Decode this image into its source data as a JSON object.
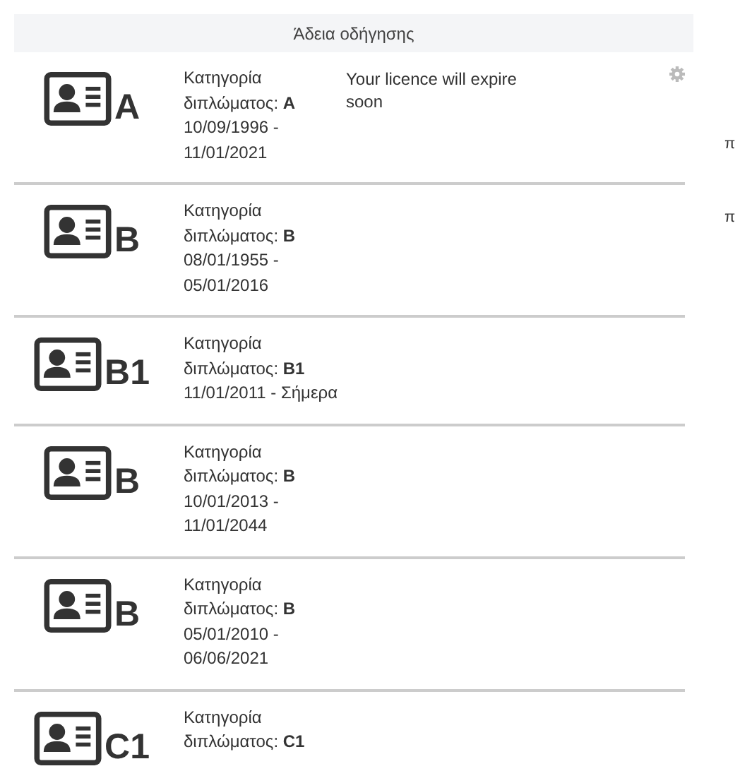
{
  "header": {
    "title": "Άδεια οδήγησης"
  },
  "licences": [
    {
      "category": "A",
      "description": "Κατηγορία διπλώματος: **A**",
      "dates": "10/09/1996 - 11/01/2021",
      "notice": "Your licence will expire soon",
      "settings": true
    },
    {
      "category": "B",
      "description": "Κατηγορία διπλώματος: **B**",
      "dates": "08/01/1955 - 05/01/2016",
      "settings": false
    },
    {
      "category": "B1",
      "description": "Κατηγορία διπλώματος: **B1**",
      "dates": "11/01/2011 - Σήμερα",
      "settings": false
    },
    {
      "category": "B",
      "description": "Κατηγορία διπλώματος: **B**",
      "dates": "10/01/2013 - 11/01/2044",
      "settings": false
    },
    {
      "category": "B",
      "description": "Κατηγορία διπλώματος: **B**",
      "dates": "05/01/2010 - 06/06/2021",
      "settings": false
    },
    {
      "category": "C1",
      "description": "Κατηγορία διπλώματος: **C1**",
      "settings": false
    }
  ],
  "edge_fragments": [
    "π",
    "π"
  ]
}
